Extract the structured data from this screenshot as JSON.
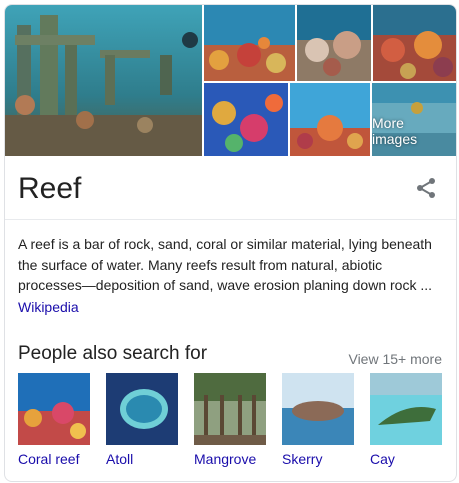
{
  "gallery": {
    "more_images_label": "More images"
  },
  "entity": {
    "title": "Reef",
    "share_icon": "share-icon",
    "description": "A reef is a bar of rock, sand, coral or similar material, lying beneath the surface of water. Many reefs result from natural, abiotic processes—deposition of sand, wave erosion planing down rock ...",
    "source_label": "Wikipedia"
  },
  "people_also_search": {
    "heading": "People also search for",
    "view_more_label": "View 15+ more",
    "items": [
      {
        "label": "Coral reef"
      },
      {
        "label": "Atoll"
      },
      {
        "label": "Mangrove"
      },
      {
        "label": "Skerry"
      },
      {
        "label": "Cay"
      }
    ]
  },
  "colors": {
    "link": "#1a0dab",
    "text": "#222222",
    "muted": "#70757a",
    "border": "#dfe1e5"
  }
}
